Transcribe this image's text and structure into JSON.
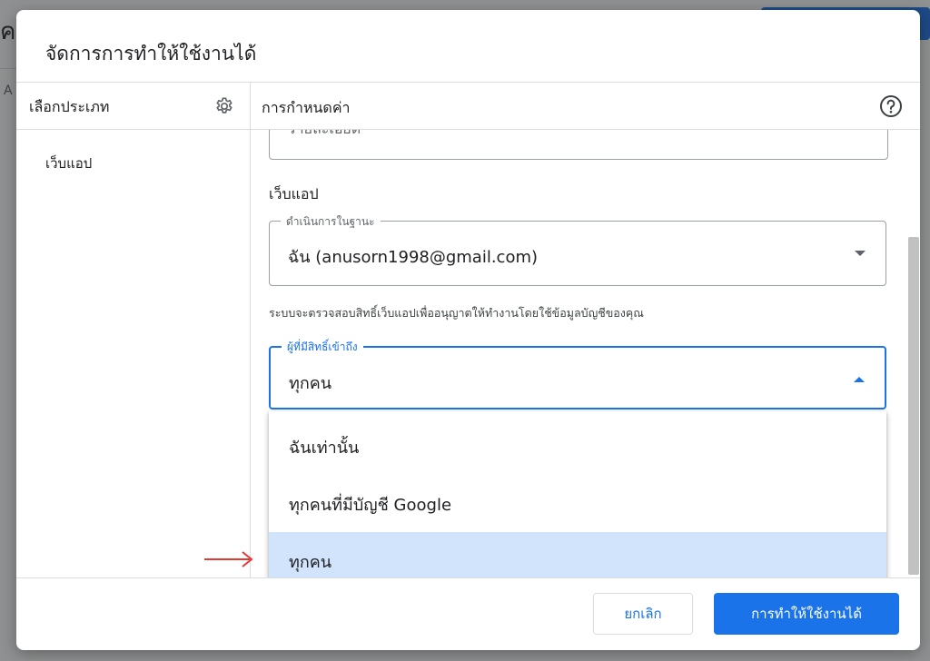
{
  "background": {
    "title_fragment": "คว",
    "left_fragment": "A"
  },
  "dialog": {
    "title": "จัดการการทำให้ใช้งานได้",
    "left_panel": {
      "header": "เลือกประเภท",
      "items": [
        "เว็บแอป"
      ]
    },
    "right_panel": {
      "header": "การกำหนดค่า",
      "description_partial": "รายละเอียด",
      "section_title": "เว็บแอป",
      "execute_as": {
        "label": "ดำเนินการในฐานะ",
        "value": "ฉัน (anusorn1998@gmail.com)",
        "helper": "ระบบจะตรวจสอบสิทธิ์เว็บแอปเพื่ออนุญาตให้ทำงานโดยใช้ข้อมูลบัญชีของคุณ"
      },
      "who_has_access": {
        "label": "ผู้ที่มีสิทธิ์เข้าถึง",
        "value": "ทุกคน",
        "options": [
          {
            "label": "ฉันเท่านั้น"
          },
          {
            "label": "ทุกคนที่มีบัญชี Google"
          },
          {
            "label": "ทุกคน"
          }
        ]
      }
    },
    "footer": {
      "cancel_label": "ยกเลิก",
      "deploy_label": "การทำให้ใช้งานได้"
    }
  },
  "colors": {
    "accent": "#1a73e8",
    "selected_option_bg": "#d2e3fc",
    "annotation_arrow": "#e53935"
  },
  "icons": {
    "settings": "gear-icon",
    "help": "help-icon",
    "dropdown_closed": "chevron-down-icon",
    "dropdown_open": "chevron-up-icon"
  }
}
